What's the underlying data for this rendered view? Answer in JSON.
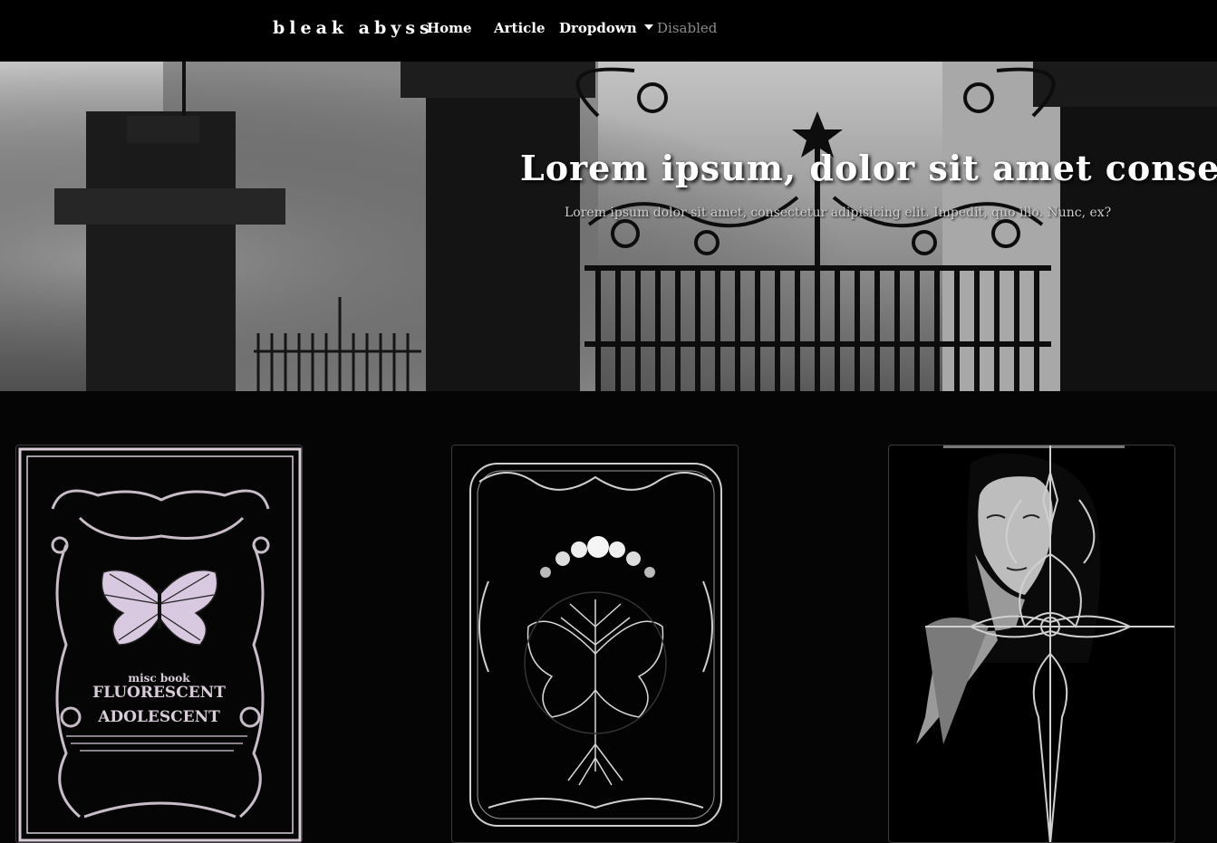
{
  "navbar": {
    "brand": "bleak abyss",
    "links": [
      {
        "label": "Home",
        "state": "normal"
      },
      {
        "label": "Article",
        "state": "normal"
      },
      {
        "label": "Dropdown",
        "state": "dropdown"
      },
      {
        "label": "Disabled",
        "state": "disabled"
      }
    ]
  },
  "hero": {
    "title": "Lorem ipsum, dolor sit amet consectetur",
    "subtitle": "Lorem ipsum dolor sit amet, consectetur adipisicing elit. Impedit, quo illo. Nunc, ex?"
  },
  "cards": [
    {
      "image": "butterfly-ornate-frame-book-cover",
      "small_text": "misc book",
      "line1": "FLUORESCENT",
      "line2": "ADOLESCENT"
    },
    {
      "image": "moon-phases-tree-butterfly-cover"
    },
    {
      "image": "gothic-woman-dagger-illustration"
    }
  ],
  "colors": {
    "background": "#050505",
    "navbar": "#000000",
    "text": "#ffffff",
    "disabled": "#8a8a8a",
    "card_border": "#3c3c3c",
    "accent_lavender": "#d8ccd8"
  }
}
